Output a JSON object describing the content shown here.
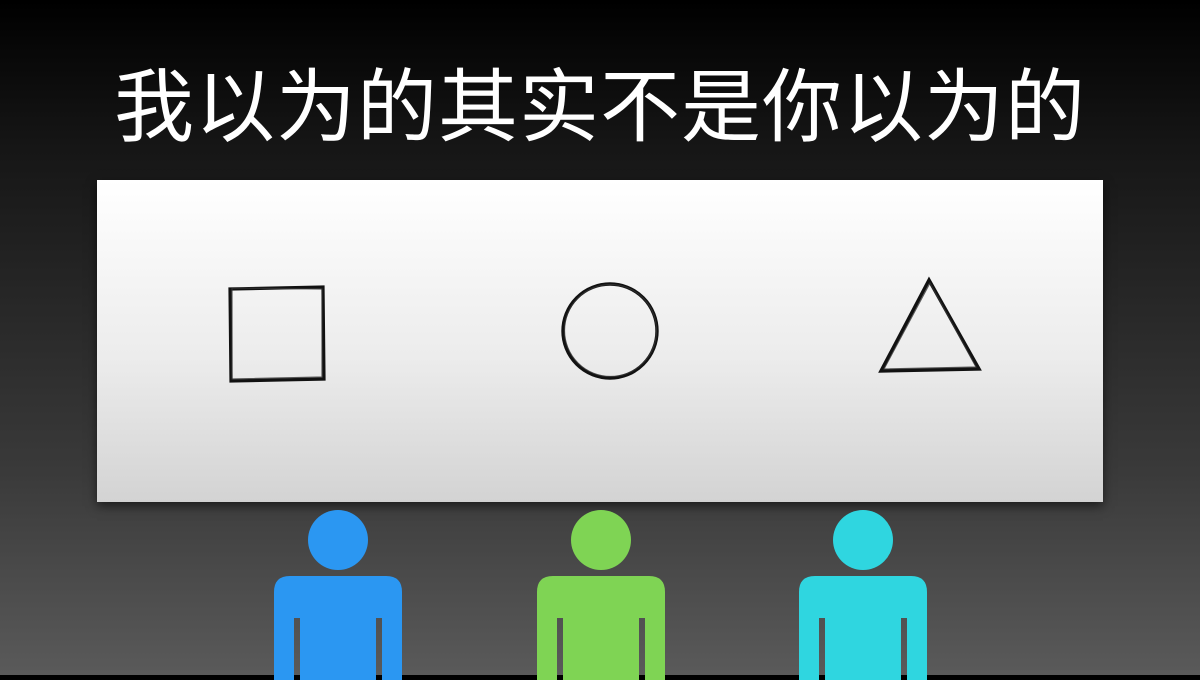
{
  "slide": {
    "title": "我以为的其实不是你以为的"
  },
  "shapes": [
    {
      "icon": "square-outline-icon"
    },
    {
      "icon": "circle-outline-icon"
    },
    {
      "icon": "triangle-outline-icon"
    }
  ],
  "people": [
    {
      "icon": "person-icon",
      "color": "#2b97f2"
    },
    {
      "icon": "person-icon",
      "color": "#7fd454"
    },
    {
      "icon": "person-icon",
      "color": "#2fd6e0"
    }
  ]
}
